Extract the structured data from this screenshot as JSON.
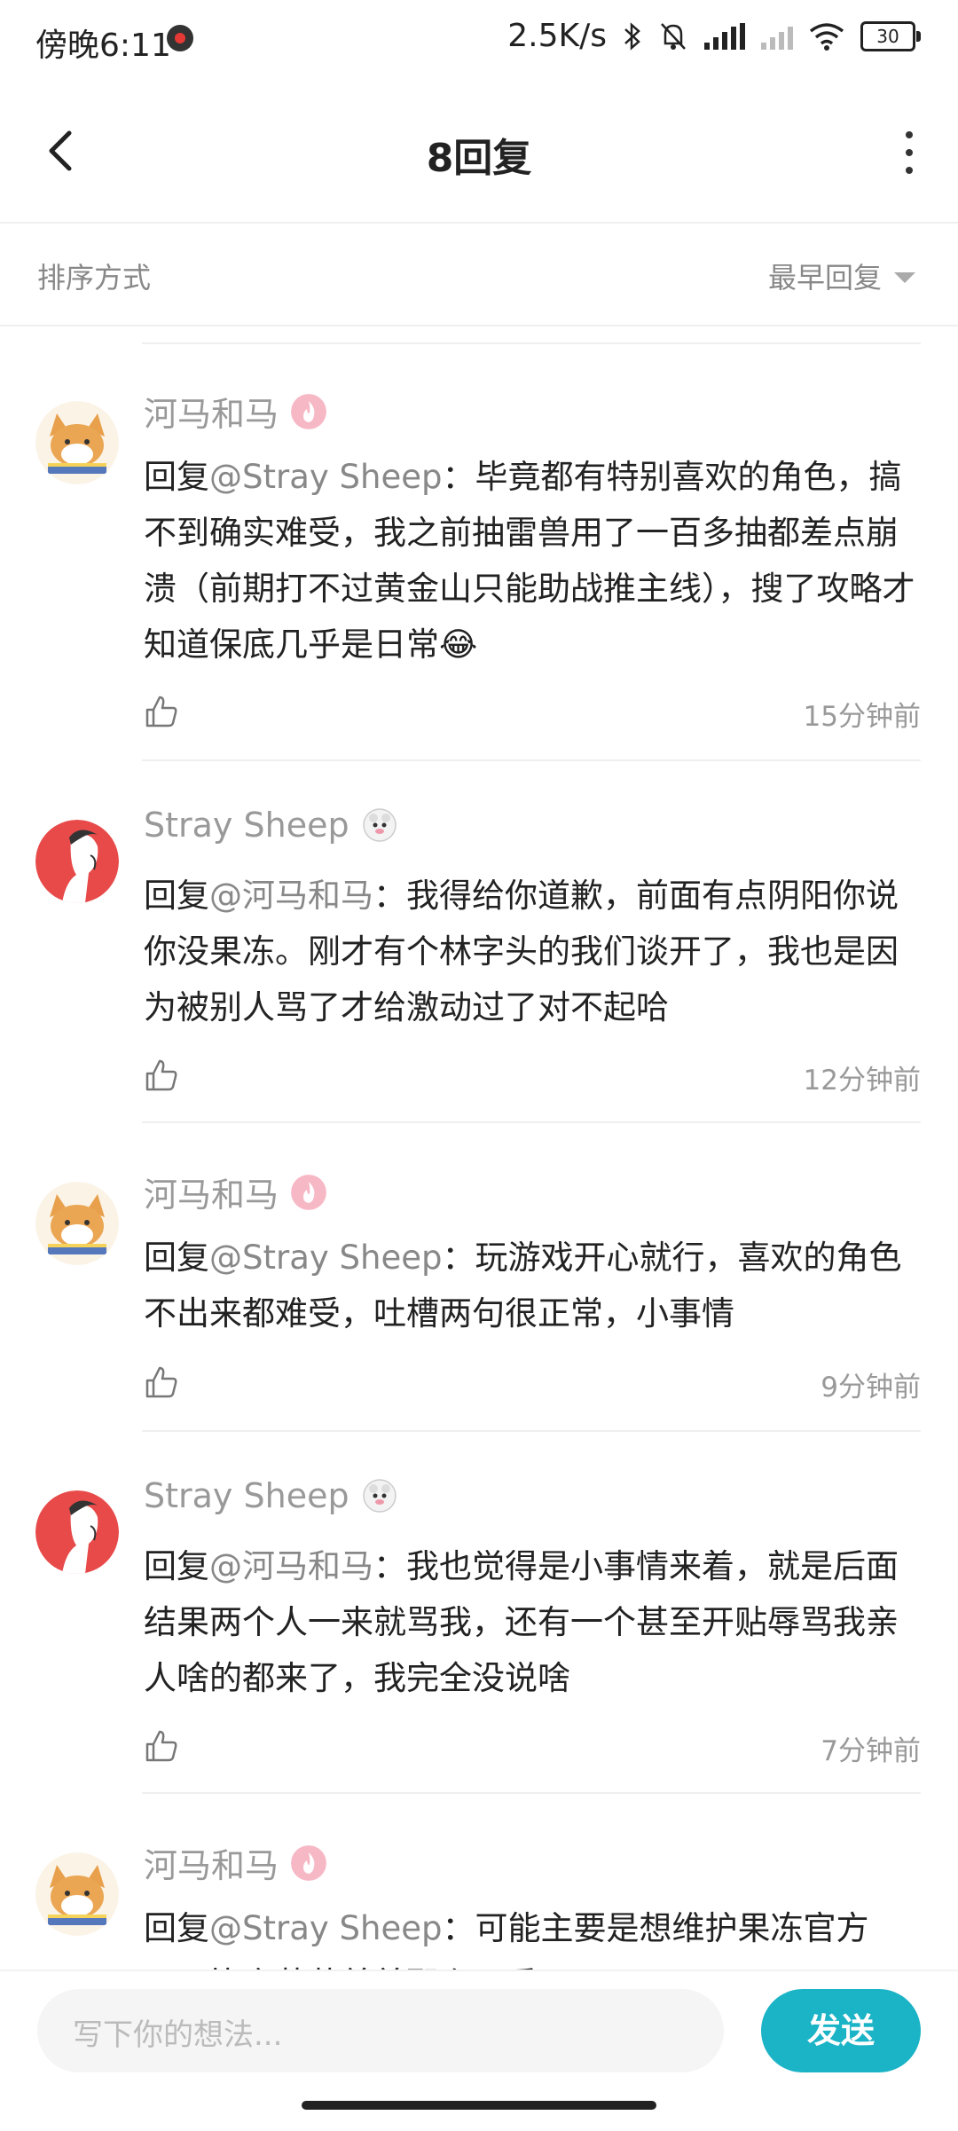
{
  "status_bar": {
    "time": "傍晚6:11",
    "net_speed": "2.5K/s",
    "battery": "30",
    "icons": [
      "recording-icon",
      "bluetooth-icon",
      "mute-icon",
      "hd-signal-icon",
      "signal-icon",
      "wifi-icon",
      "battery-icon"
    ]
  },
  "header": {
    "title": "8回复"
  },
  "sort": {
    "label": "排序方式",
    "value": "最早回复"
  },
  "replies": [
    {
      "user": "河马和马",
      "reply_prefix": "回复",
      "mention": "@Stray Sheep",
      "text": "：毕竟都有特别喜欢的角色，搞不到确实难受，我之前抽雷兽用了一百多抽都差点崩溃（前期打不过黄金山只能助战推主线），搜了攻略才知道保底几乎是日常😂",
      "time": "15分钟前"
    },
    {
      "user": "Stray Sheep",
      "reply_prefix": "回复",
      "mention": "@河马和马",
      "text": "：我得给你道歉，前面有点阴阳你说你没果冻。刚才有个林字头的我们谈开了，我也是因为被别人骂了才给激动过了对不起哈",
      "time": "12分钟前"
    },
    {
      "user": "河马和马",
      "reply_prefix": "回复",
      "mention": "@Stray Sheep",
      "text": "：玩游戏开心就行，喜欢的角色不出来都难受，吐槽两句很正常，小事情",
      "time": "9分钟前"
    },
    {
      "user": "Stray Sheep",
      "reply_prefix": "回复",
      "mention": "@河马和马",
      "text": "：我也觉得是小事情来着，就是后面结果两个人一来就骂我，还有一个甚至开贴辱骂我亲人啥的都来了，我完全没说啥",
      "time": "7分钟前"
    },
    {
      "user": "河马和马",
      "reply_prefix": "回复",
      "mention": "@Stray Sheep",
      "text": "：可能主要是想维护果冻官方吧，毕竟苹萃差差那么可爱"
    }
  ],
  "input": {
    "placeholder": "写下你的想法...",
    "send_label": "发送"
  },
  "colors": {
    "accent": "#1bb3c6",
    "text_muted": "#999999"
  }
}
